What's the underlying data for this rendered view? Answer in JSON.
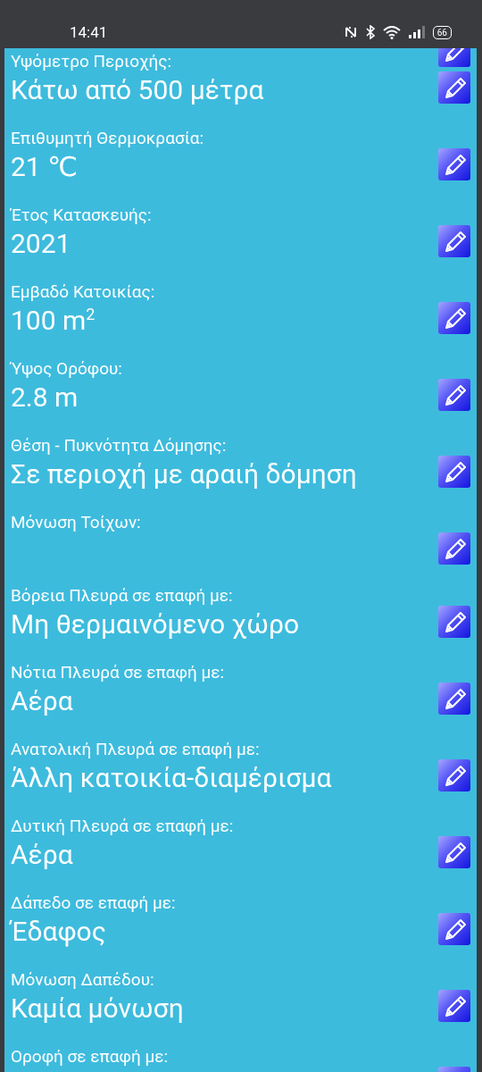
{
  "status_bar": {
    "time": "14:41",
    "battery": "66"
  },
  "fields": [
    {
      "label": "Υψόμετρο Περιοχής:",
      "value": "Κάτω από 500 μέτρα"
    },
    {
      "label": "Επιθυμητή Θερμοκρασία:",
      "value": "21 ℃"
    },
    {
      "label": "Έτος Κατασκευής:",
      "value": "2021"
    },
    {
      "label": "Εμβαδό Κατοικίας:",
      "value": "100 m$^{2}$"
    },
    {
      "label": "Ύψος Ορόφου:",
      "value": "2.8 m"
    },
    {
      "label": "Θέση - Πυκνότητα Δόμησης:",
      "value": "Σε περιοχή με αραιή δόμηση"
    },
    {
      "label": "Μόνωση Τοίχων:"
    },
    {
      "label": "Βόρεια Πλευρά σε επαφή με:",
      "value": "Μη θερμαινόμενο χώρο"
    },
    {
      "label": "Νότια Πλευρά σε επαφή με:",
      "value": "Αέρα"
    },
    {
      "label": "Ανατολική Πλευρά σε επαφή με:",
      "value": "Άλλη κατοικία-διαμέρισμα"
    },
    {
      "label": "Δυτική Πλευρά σε επαφή με:",
      "value": "Αέρα"
    },
    {
      "label": "Δάπεδο σε επαφή με:",
      "value": "Έδαφος"
    },
    {
      "label": "Μόνωση Δαπέδου:",
      "value": "Καμία μόνωση"
    },
    {
      "label": "Οροφή σε επαφή με:"
    }
  ]
}
